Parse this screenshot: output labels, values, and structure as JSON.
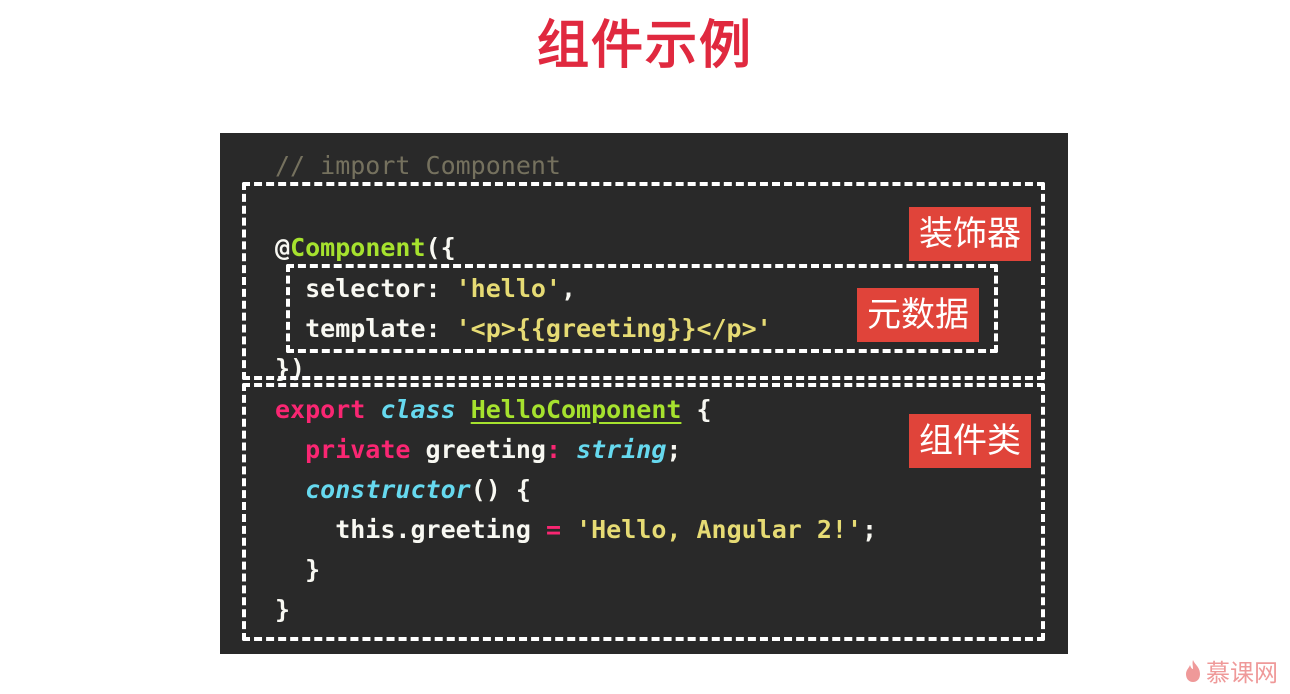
{
  "slide": {
    "title": "组件示例"
  },
  "code": {
    "lines": [
      [
        {
          "t": "// import Component",
          "c": "comment"
        }
      ],
      [],
      [
        {
          "t": "@",
          "c": "at"
        },
        {
          "t": "Component",
          "c": "green"
        },
        {
          "t": "({",
          "c": "white"
        }
      ],
      [
        {
          "t": "  selector",
          "c": "white"
        },
        {
          "t": ": ",
          "c": "white"
        },
        {
          "t": "'hello'",
          "c": "string"
        },
        {
          "t": ",",
          "c": "white"
        }
      ],
      [
        {
          "t": "  template",
          "c": "white"
        },
        {
          "t": ": ",
          "c": "white"
        },
        {
          "t": "'<p>{{greeting}}</p>'",
          "c": "string"
        }
      ],
      [
        {
          "t": "})",
          "c": "white"
        }
      ],
      [
        {
          "t": "export",
          "c": "pink"
        },
        {
          "t": " ",
          "c": "white"
        },
        {
          "t": "class",
          "c": "blue"
        },
        {
          "t": " ",
          "c": "white"
        },
        {
          "t": "HelloComponent",
          "c": "green underline"
        },
        {
          "t": " {",
          "c": "white"
        }
      ],
      [
        {
          "t": "  private",
          "c": "pink"
        },
        {
          "t": " greeting",
          "c": "white"
        },
        {
          "t": ":",
          "c": "pink"
        },
        {
          "t": " ",
          "c": "white"
        },
        {
          "t": "string",
          "c": "blue"
        },
        {
          "t": ";",
          "c": "white"
        }
      ],
      [
        {
          "t": "  ",
          "c": "white"
        },
        {
          "t": "constructor",
          "c": "blue"
        },
        {
          "t": "() {",
          "c": "white"
        }
      ],
      [
        {
          "t": "    this.greeting ",
          "c": "white"
        },
        {
          "t": "=",
          "c": "pink"
        },
        {
          "t": " ",
          "c": "white"
        },
        {
          "t": "'Hello, Angular 2!'",
          "c": "string"
        },
        {
          "t": ";",
          "c": "white"
        }
      ],
      [
        {
          "t": "  }",
          "c": "white"
        }
      ],
      [
        {
          "t": "}",
          "c": "white"
        }
      ]
    ]
  },
  "tags": {
    "decorator": "装饰器",
    "metadata": "元数据",
    "component_class": "组件类"
  },
  "colors": {
    "title": "#e0293f",
    "tag_bg": "#e0443a",
    "panel_bg": "#292929"
  },
  "watermark": {
    "icon": "flame-icon",
    "text": "慕课网"
  }
}
